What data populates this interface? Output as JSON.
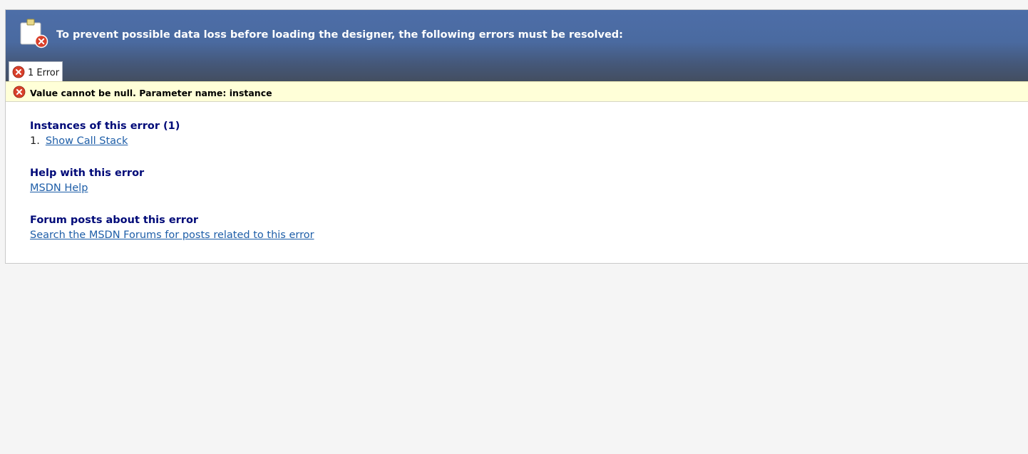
{
  "header": {
    "title": "To prevent possible data loss before loading the designer, the following errors must be resolved:",
    "icon": "clipboard-error-icon"
  },
  "tab": {
    "label": "1 Error",
    "icon": "error-icon"
  },
  "error_message": {
    "text": "Value cannot be null. Parameter name: instance",
    "icon": "error-icon"
  },
  "sections": {
    "instances": {
      "title": "Instances of this error (1)",
      "item_number": "1.",
      "link": "Show Call Stack"
    },
    "help": {
      "title": "Help with this error",
      "link": "MSDN Help"
    },
    "forum": {
      "title": "Forum posts about this error",
      "link": "Search the MSDN Forums for posts related to this error"
    }
  },
  "colors": {
    "header_top": "#4d6ea8",
    "header_bottom": "#434e60",
    "message_bar": "#ffffd8",
    "section_title": "#000a78",
    "link": "#1e5ea8",
    "error_red": "#d9402b"
  }
}
